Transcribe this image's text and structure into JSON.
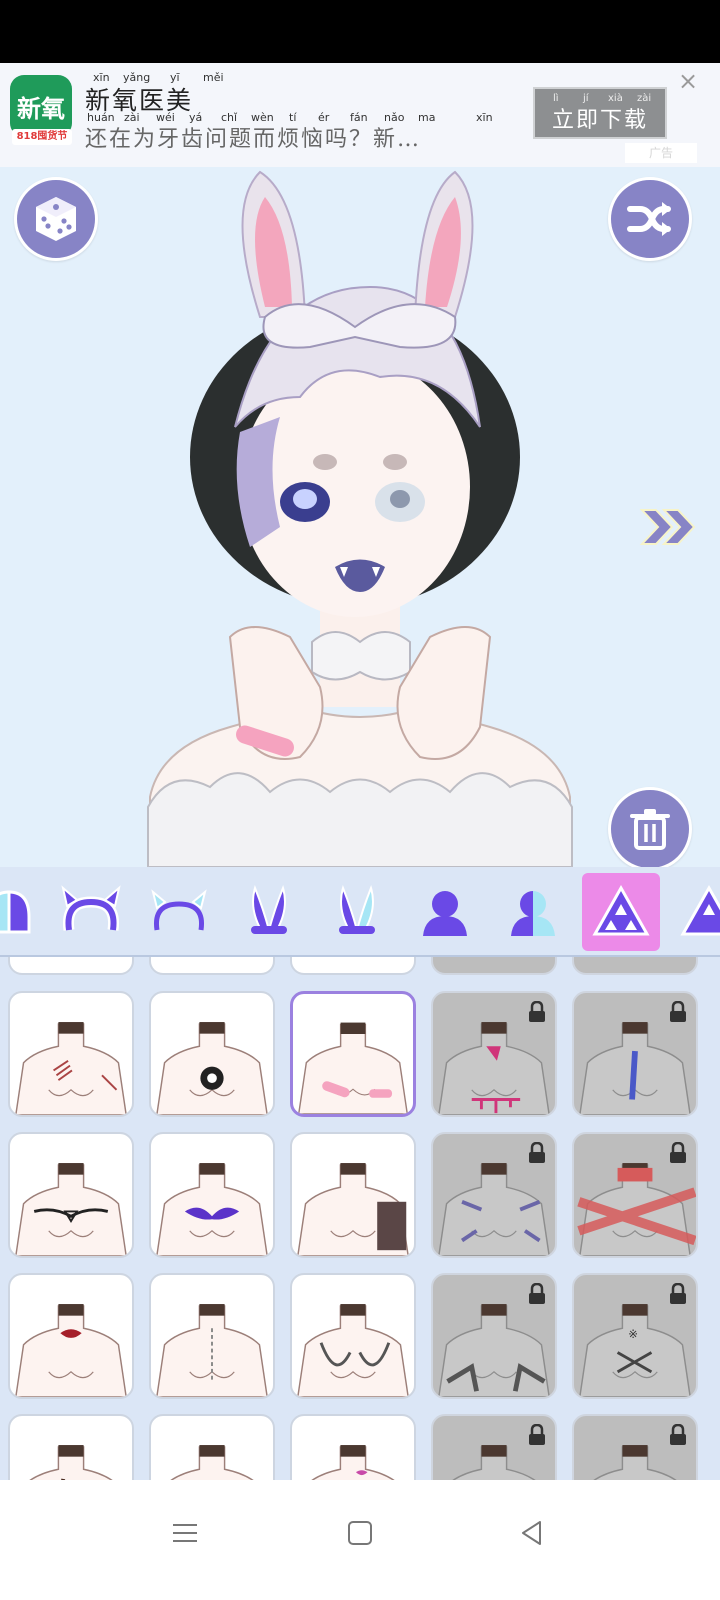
{
  "ad": {
    "title_pinyin": [
      "xīn",
      "yǎng",
      "yī",
      "měi"
    ],
    "title": "新氧医美",
    "desc_pinyin": [
      "huán",
      "zài",
      "wéi",
      "yá",
      "chǐ",
      "wèn",
      "tí",
      "ér",
      "fán",
      "nǎo",
      "ma",
      "xīn"
    ],
    "description": "还在为牙齿问题而烦恼吗？新…",
    "cta_pinyin": [
      "lì",
      "jí",
      "xià",
      "zài"
    ],
    "cta_label": "立即下载",
    "logo_text": "新氧",
    "logo_sub": "818囤货节",
    "close": "×",
    "watermark": "广告"
  },
  "toolbar": {
    "random_icon": "dice-icon",
    "shuffle_icon": "shuffle-icon",
    "next_icon": "double-chevron-right-icon",
    "delete_icon": "trash-icon"
  },
  "categories": [
    {
      "name": "ear-half",
      "active": false
    },
    {
      "name": "horns-headband",
      "active": false
    },
    {
      "name": "horns-headband-outline",
      "active": false
    },
    {
      "name": "bunny-ears",
      "active": false
    },
    {
      "name": "bunny-ears-half",
      "active": false
    },
    {
      "name": "body-silhouette",
      "active": false
    },
    {
      "name": "body-silhouette-half",
      "active": false
    },
    {
      "name": "triforce",
      "active": true
    },
    {
      "name": "triforce-partial",
      "active": false
    }
  ],
  "colors": {
    "accent": "#8784c6",
    "active_category": "#ec8ae8",
    "selected_border": "#9b81e0",
    "panel_bg": "#dbe6f6",
    "canvas_bg": "#e3f0fb"
  },
  "tiles": [
    {
      "row": 1,
      "col": 1,
      "locked": false,
      "selected": false,
      "mark": "scars"
    },
    {
      "row": 1,
      "col": 2,
      "locked": false,
      "selected": false,
      "mark": "bagua-tattoo"
    },
    {
      "row": 1,
      "col": 3,
      "locked": false,
      "selected": true,
      "mark": "bandages"
    },
    {
      "row": 1,
      "col": 4,
      "locked": true,
      "selected": false,
      "mark": "blood-drips"
    },
    {
      "row": 1,
      "col": 5,
      "locked": true,
      "selected": false,
      "mark": "stitched-wound"
    },
    {
      "row": 2,
      "col": 1,
      "locked": false,
      "selected": false,
      "mark": "antler-tattoo"
    },
    {
      "row": 2,
      "col": 2,
      "locked": false,
      "selected": false,
      "mark": "tribal-tattoo"
    },
    {
      "row": 2,
      "col": 3,
      "locked": false,
      "selected": false,
      "mark": "shoulder-pattern"
    },
    {
      "row": 2,
      "col": 4,
      "locked": true,
      "selected": false,
      "mark": "tiger-stripes"
    },
    {
      "row": 2,
      "col": 5,
      "locked": true,
      "selected": false,
      "mark": "red-ribbon"
    },
    {
      "row": 3,
      "col": 1,
      "locked": false,
      "selected": false,
      "mark": "mouth-tattoo"
    },
    {
      "row": 3,
      "col": 2,
      "locked": false,
      "selected": false,
      "mark": "spine-text"
    },
    {
      "row": 3,
      "col": 3,
      "locked": false,
      "selected": false,
      "mark": "dragon-tattoo"
    },
    {
      "row": 3,
      "col": 4,
      "locked": true,
      "selected": false,
      "mark": "claw-hands"
    },
    {
      "row": 3,
      "col": 5,
      "locked": true,
      "selected": false,
      "mark": "sword-tattoo"
    },
    {
      "row": 4,
      "col": 1,
      "locked": false,
      "selected": false,
      "mark": "branch"
    },
    {
      "row": 4,
      "col": 2,
      "locked": false,
      "selected": false,
      "mark": "plain"
    },
    {
      "row": 4,
      "col": 3,
      "locked": false,
      "selected": false,
      "mark": "lips"
    },
    {
      "row": 4,
      "col": 4,
      "locked": true,
      "selected": false,
      "mark": "plain"
    },
    {
      "row": 4,
      "col": 5,
      "locked": true,
      "selected": false,
      "mark": "plain"
    }
  ],
  "nav": {
    "menu_icon": "menu-icon",
    "home_icon": "home-square-icon",
    "back_icon": "back-triangle-icon"
  }
}
